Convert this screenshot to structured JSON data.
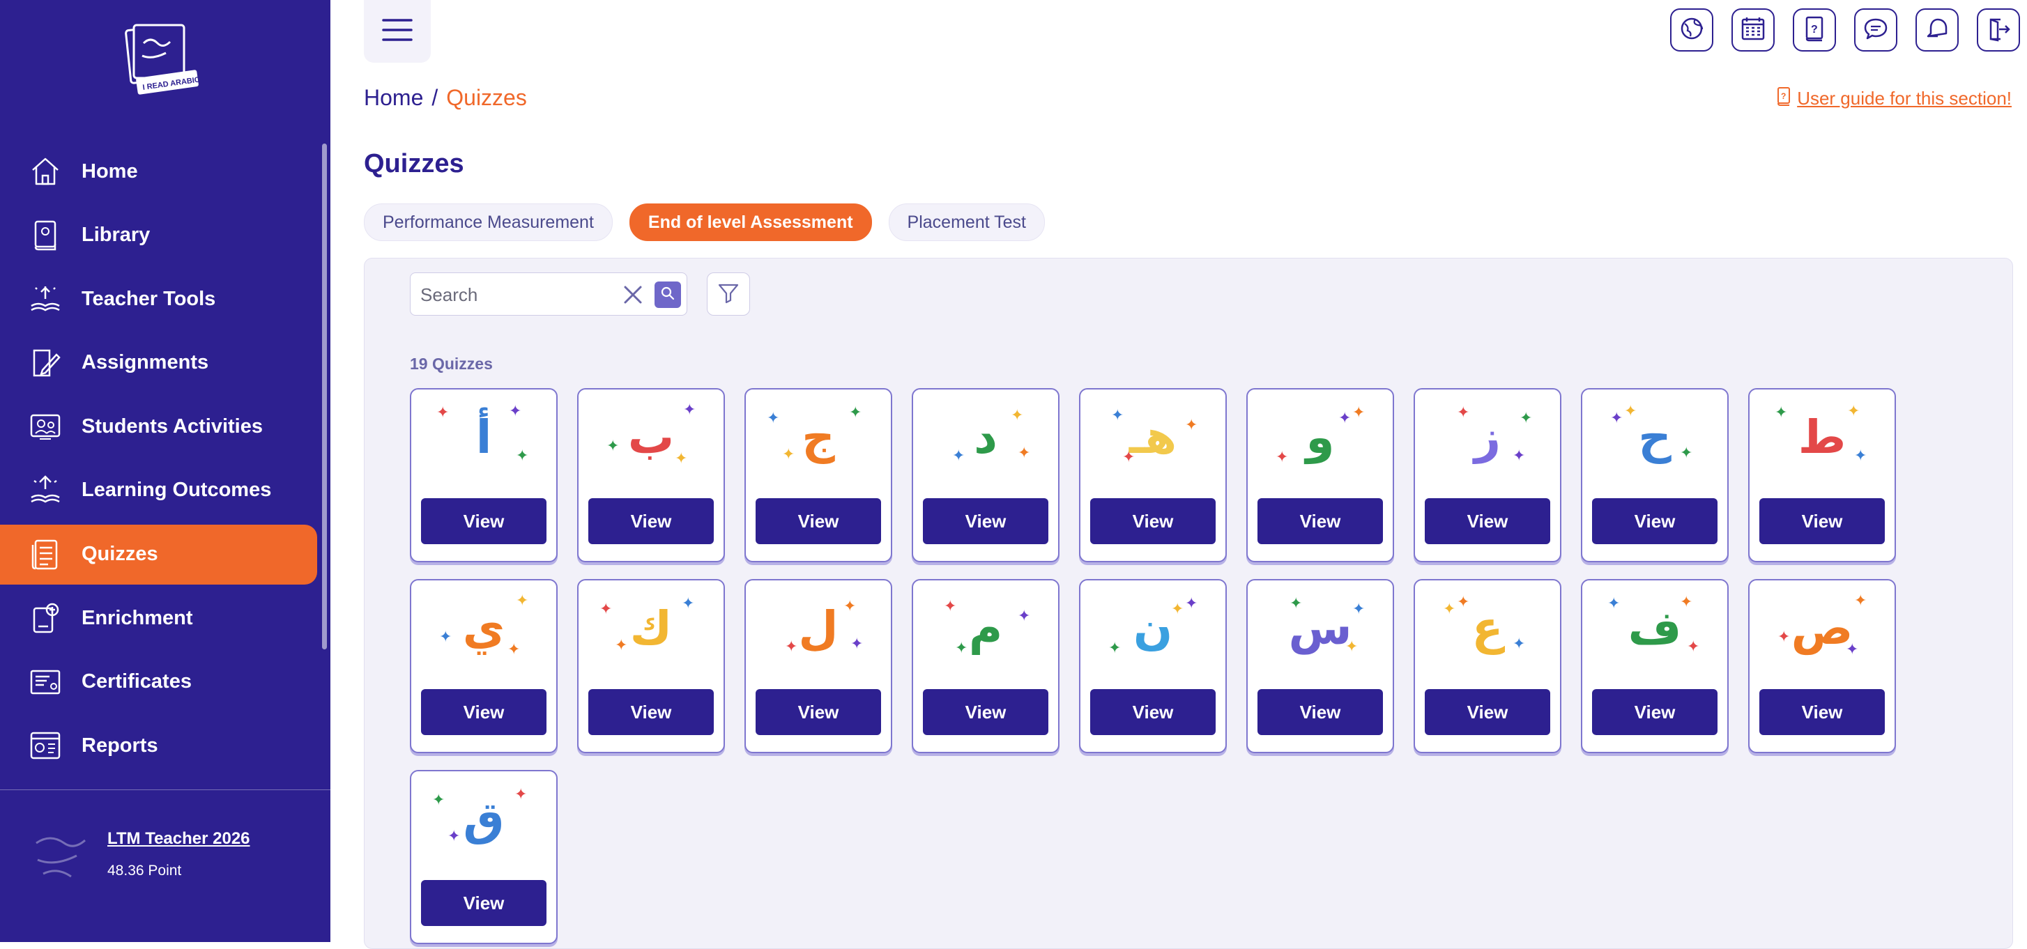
{
  "sidebar": {
    "logo_text": "اقرأ بالعربية I READ ARABIC",
    "items": [
      {
        "label": "Home",
        "icon": "home-icon",
        "active": false
      },
      {
        "label": "Library",
        "icon": "library-icon",
        "active": false
      },
      {
        "label": "Teacher Tools",
        "icon": "teacher-tools-icon",
        "active": false
      },
      {
        "label": "Assignments",
        "icon": "assignments-icon",
        "active": false
      },
      {
        "label": "Students Activities",
        "icon": "students-activities-icon",
        "active": false
      },
      {
        "label": "Learning Outcomes",
        "icon": "learning-outcomes-icon",
        "active": false
      },
      {
        "label": "Quizzes",
        "icon": "quizzes-icon",
        "active": true
      },
      {
        "label": "Enrichment",
        "icon": "enrichment-icon",
        "active": false
      },
      {
        "label": "Certificates",
        "icon": "certificates-icon",
        "active": false
      },
      {
        "label": "Reports",
        "icon": "reports-icon",
        "active": false
      }
    ],
    "user": {
      "name": "LTM Teacher 2026",
      "points": "48.36 Point"
    }
  },
  "topbar": {
    "icons": [
      "globe-icon",
      "calendar-icon",
      "help-book-icon",
      "chat-icon",
      "notification-icon",
      "logout-icon"
    ]
  },
  "breadcrumb": {
    "home": "Home",
    "separator": "/",
    "current": "Quizzes"
  },
  "guide_link": "User guide for this section!",
  "page_title": "Quizzes",
  "tabs": [
    {
      "label": "Performance Measurement",
      "active": false
    },
    {
      "label": "End of level Assessment",
      "active": true
    },
    {
      "label": "Placement Test",
      "active": false
    }
  ],
  "search": {
    "placeholder": "Search"
  },
  "count_label": "19 Quizzes",
  "view_label": "View",
  "quizzes": [
    {
      "letter": "أ",
      "color": "#3a7fd5"
    },
    {
      "letter": "ب",
      "color": "#e34848"
    },
    {
      "letter": "ج",
      "color": "#f07b23"
    },
    {
      "letter": "د",
      "color": "#2e9a4a"
    },
    {
      "letter": "هـ",
      "color": "#f2c94c"
    },
    {
      "letter": "و",
      "color": "#2e9a4a"
    },
    {
      "letter": "ز",
      "color": "#7b6be0"
    },
    {
      "letter": "ح",
      "color": "#3a7fd5"
    },
    {
      "letter": "ط",
      "color": "#e34848"
    },
    {
      "letter": "ي",
      "color": "#f07b23"
    },
    {
      "letter": "ك",
      "color": "#f2b632"
    },
    {
      "letter": "ل",
      "color": "#f07b23"
    },
    {
      "letter": "م",
      "color": "#2e9a4a"
    },
    {
      "letter": "ن",
      "color": "#3aa0e0"
    },
    {
      "letter": "س",
      "color": "#6a5fd0"
    },
    {
      "letter": "ع",
      "color": "#f2b632"
    },
    {
      "letter": "ف",
      "color": "#2e9a4a"
    },
    {
      "letter": "ص",
      "color": "#f07b23"
    },
    {
      "letter": "ق",
      "color": "#3a7fd5"
    }
  ]
}
